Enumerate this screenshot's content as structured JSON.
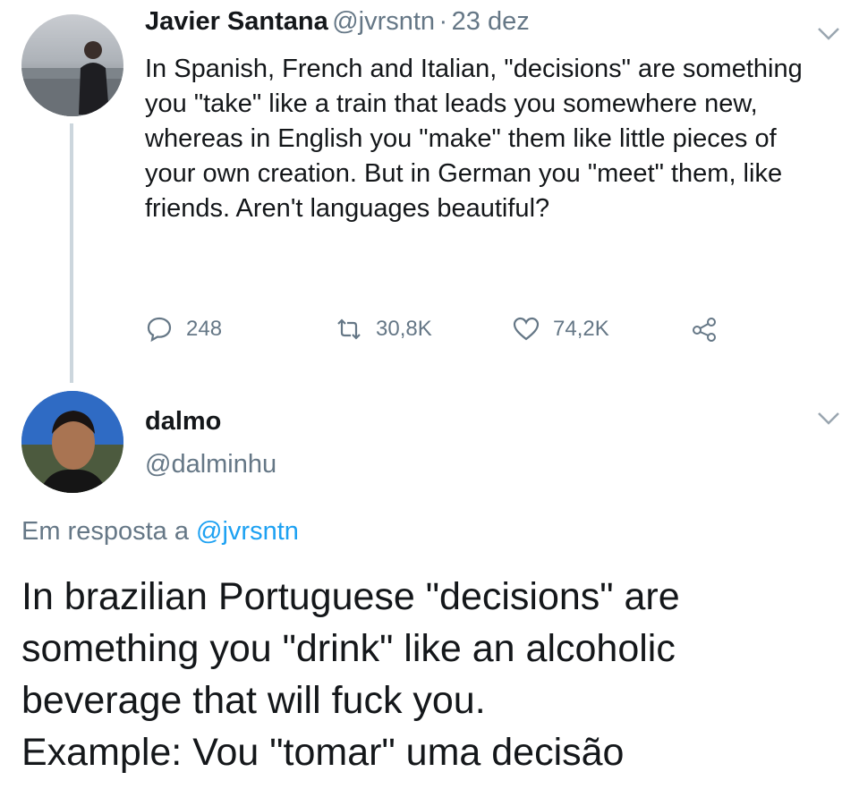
{
  "tweet": {
    "author_name": "Javier Santana",
    "handle": "@jvrsntn",
    "separator": "·",
    "date": "23 dez",
    "text": "In Spanish, French and Italian, \"decisions\" are something you \"take\" like a train that leads you somewhere new, whereas in English you \"make\" them like little pieces of your own creation. But in German you \"meet\" them, like friends. Aren't languages beautiful?",
    "stats": {
      "replies": "248",
      "retweets": "30,8K",
      "likes": "74,2K"
    },
    "icons": [
      "reply-icon",
      "retweet-icon",
      "like-icon",
      "share-icon",
      "chevron-down-icon"
    ]
  },
  "reply": {
    "author_name": "dalmo",
    "handle": "@dalminhu",
    "reply_prefix": "Em resposta a",
    "reply_mention": "@jvrsntn",
    "lines": [
      "In brazilian Portuguese \"decisions\" are",
      "something you \"drink\" like an alcoholic",
      "beverage that will fuck you.",
      "Example: Vou \"tomar\" uma decisão"
    ]
  },
  "colors": {
    "text": "#14171a",
    "secondary": "#657786",
    "link": "#1da1f2",
    "thread_line": "#ccd6dd"
  }
}
